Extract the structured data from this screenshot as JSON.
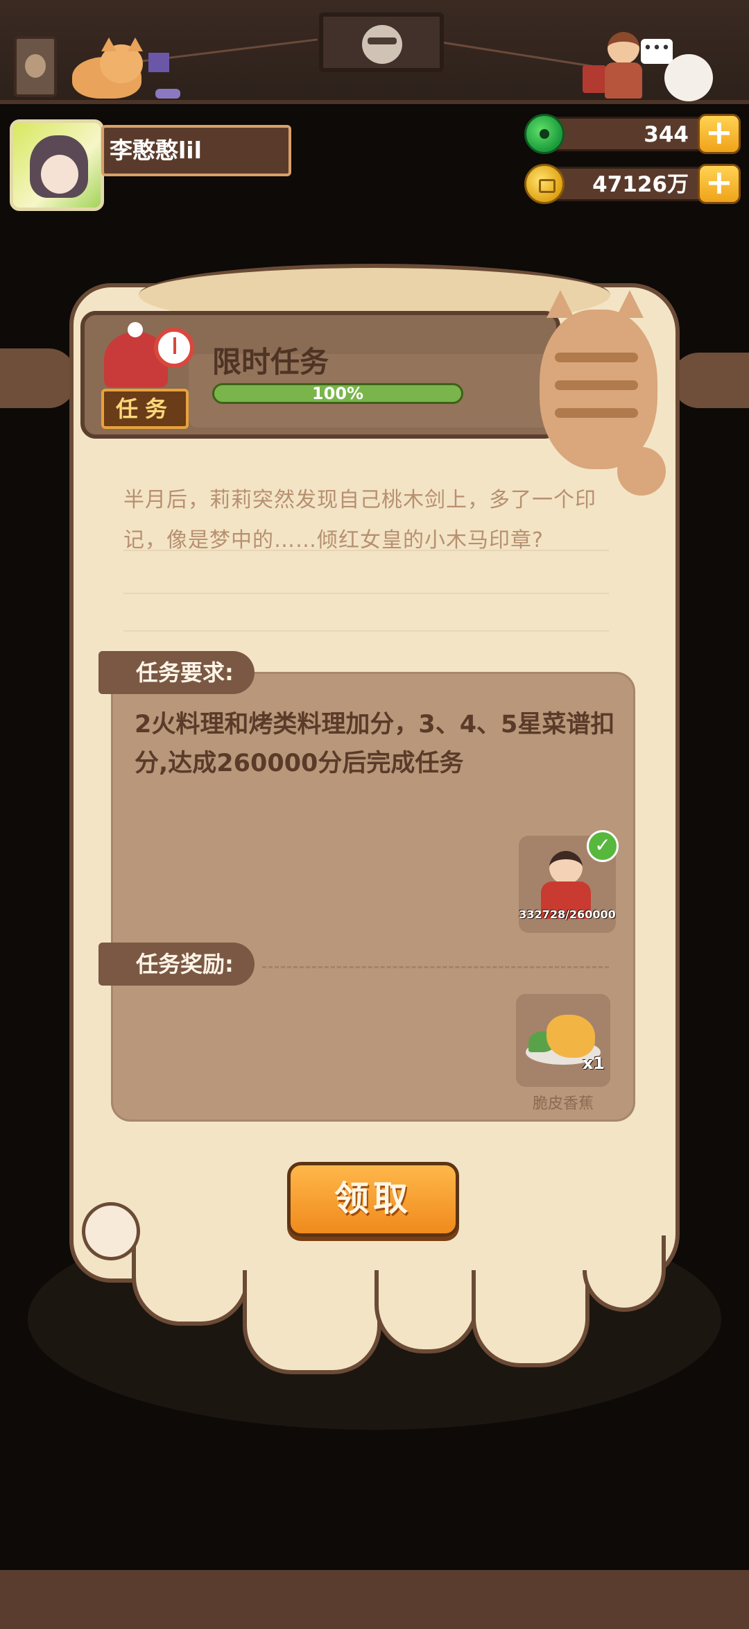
{
  "user": {
    "name": "李憨憨lil"
  },
  "currency": {
    "jade": "344",
    "gold": "47126万"
  },
  "task": {
    "badge_label": "任务",
    "title": "限时任务",
    "progress_label": "100%",
    "progress_fraction": 1.0,
    "story": "半月后，莉莉突然发现自己桃木剑上，多了一个印记，像是梦中的……倾红女皇的小木马印章?",
    "requirement_heading": "任务要求:",
    "requirement_text": "2火料理和烤类料理加分，3、4、5星菜谱扣分,达成260000分后完成任务",
    "requirement_progress": "332728/260000",
    "requirement_complete": true,
    "reward_heading": "任务奖励:",
    "reward_name": "脆皮香蕉",
    "reward_qty": "x1",
    "claim_label": "领取"
  },
  "colors": {
    "progress_green": "#79b54a",
    "claim_orange": "#f08a1c",
    "check_green": "#58b83e"
  },
  "icons": [
    "jade-icon",
    "gold-coin-icon",
    "plus-icon",
    "check-icon",
    "clock-icon",
    "chef-hat-icon"
  ]
}
